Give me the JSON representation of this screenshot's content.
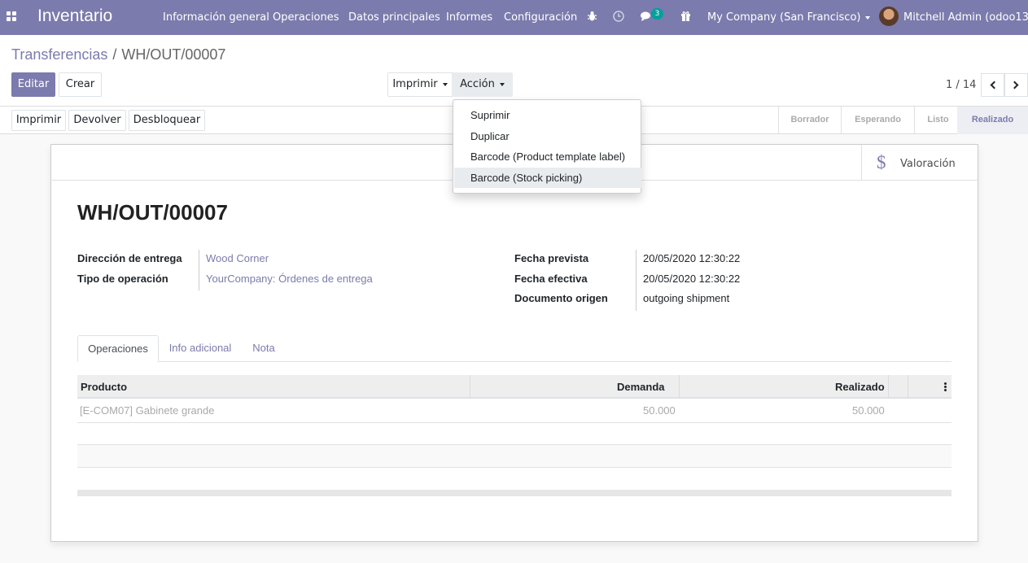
{
  "topbar": {
    "app_title": "Inventario",
    "menu": [
      "Información general",
      "Operaciones",
      "Datos principales",
      "Informes",
      "Configuración"
    ],
    "messages_badge": "3",
    "company": "My Company (San Francisco)",
    "user": "Mitchell Admin (odoo13)"
  },
  "breadcrumb": {
    "parent": "Transferencias",
    "separator": "/",
    "current": "WH/OUT/00007"
  },
  "toolbar": {
    "edit": "Editar",
    "create": "Crear",
    "print": "Imprimir",
    "action": "Acción"
  },
  "pager": {
    "value": "1 / 14"
  },
  "status_buttons": {
    "print": "Imprimir",
    "return": "Devolver",
    "unlock": "Desbloquear"
  },
  "stages": [
    "Borrador",
    "Esperando",
    "Listo",
    "Realizado"
  ],
  "active_stage": "Realizado",
  "smart_button": {
    "label": "Valoración",
    "icon": "dollar-icon"
  },
  "record": {
    "name": "WH/OUT/00007",
    "left_fields": [
      {
        "label": "Dirección de entrega",
        "value": "Wood Corner"
      },
      {
        "label": "Tipo de operación",
        "value": "YourCompany: Órdenes de entrega"
      }
    ],
    "right_fields": [
      {
        "label": "Fecha prevista",
        "value": "20/05/2020 12:30:22"
      },
      {
        "label": "Fecha efectiva",
        "value": "20/05/2020 12:30:22"
      },
      {
        "label": "Documento origen",
        "value": "outgoing shipment"
      }
    ]
  },
  "tabs": [
    "Operaciones",
    "Info adicional",
    "Nota"
  ],
  "table": {
    "columns": [
      "Producto",
      "Demanda",
      "Realizado"
    ],
    "rows": [
      {
        "product": "[E-COM07] Gabinete grande",
        "demand": "50.000",
        "done": "50.000"
      }
    ]
  },
  "action_menu": {
    "items": [
      "Suprimir",
      "Duplicar",
      "Barcode (Product template label)",
      "Barcode (Stock picking)"
    ],
    "hovered": "Barcode (Stock picking)"
  },
  "colors": {
    "brand": "#7c7bad",
    "badge": "#00a09d"
  }
}
